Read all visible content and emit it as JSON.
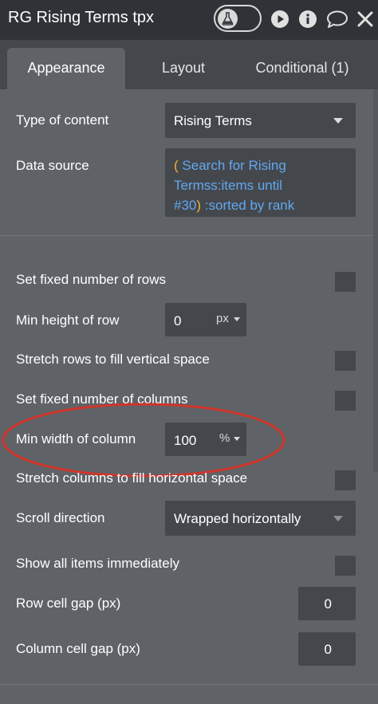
{
  "panel": {
    "title": "RG Rising Terms tpx",
    "icons": [
      "flask-icon",
      "play-icon",
      "info-icon",
      "comment-icon",
      "close-icon"
    ]
  },
  "tabs": [
    {
      "label": "Appearance",
      "active": true
    },
    {
      "label": "Layout",
      "active": false
    },
    {
      "label": "Conditional (1)",
      "active": false
    }
  ],
  "type_of_content": {
    "label": "Type of content",
    "value": "Rising Terms"
  },
  "data_source": {
    "label": "Data source",
    "lines": [
      "Search for Rising",
      "Termss:items until",
      "#30"
    ],
    "open_paren": "(",
    "close_paren": ")",
    "suffix": ":sorted by rank"
  },
  "rows": {
    "fixed_rows_label": "Set fixed number of rows",
    "fixed_rows_checked": false,
    "min_height_label": "Min height of row",
    "min_height_value": "0",
    "min_height_unit": "px",
    "stretch_rows_label": "Stretch rows to fill vertical space",
    "stretch_rows_checked": false,
    "fixed_cols_label": "Set fixed number of columns",
    "fixed_cols_checked": false,
    "min_width_label": "Min width of column",
    "min_width_value": "100",
    "min_width_unit": "%",
    "stretch_cols_label": "Stretch columns to fill horizontal space",
    "stretch_cols_checked": false,
    "scroll_dir_label": "Scroll direction",
    "scroll_dir_value": "Wrapped horizontally",
    "show_all_label": "Show all items immediately",
    "show_all_checked": false,
    "row_gap_label": "Row cell gap (px)",
    "row_gap_value": "0",
    "col_gap_label": "Column cell gap (px)",
    "col_gap_value": "0"
  },
  "colors": {
    "panel_bg": "#5f6368",
    "field_bg": "#44484d",
    "titlebar_bg": "#2f3338",
    "expression_blue": "#63a7ee",
    "paren_orange": "#f0b429",
    "highlight_red": "#d0352b"
  }
}
